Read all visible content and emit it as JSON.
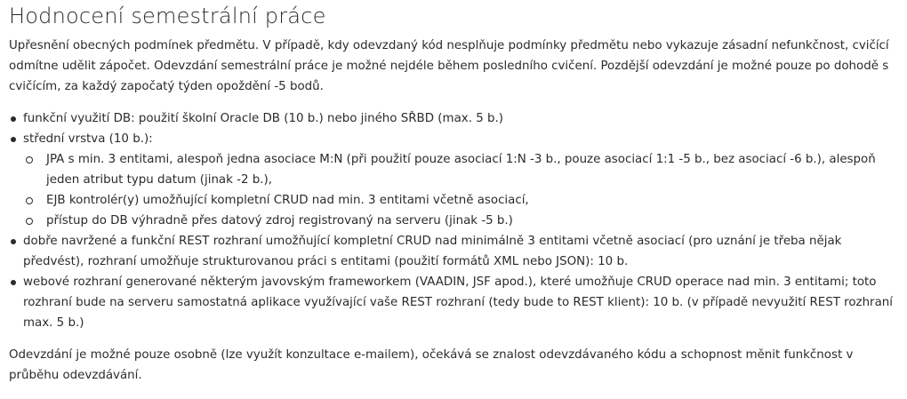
{
  "title": "Hodnocení semestrální práce",
  "intro": "Upřesnění obecných podmínek předmětu. V případě, kdy odevzdaný kód nesplňuje podmínky předmětu nebo vykazuje zásadní nefunkčnost, cvičící odmítne udělit zápočet. Odevzdání semestrální práce je možné nejdéle během posledního cvičení. Pozdější odevzdání je možné pouze po dohodě s cvičícím, za každý započatý týden opoždění -5 bodů.",
  "criteria": [
    {
      "text": "funkční využití DB: použití školní Oracle DB (10 b.) nebo jiného SŘBD (max. 5 b.)"
    },
    {
      "text": "střední vrstva (10 b.):",
      "sub": [
        "JPA s min. 3 entitami, alespoň jedna asociace M:N (při použití pouze asociací 1:N -3 b., pouze asociací 1:1 -5 b., bez asociací -6 b.), alespoň jeden atribut typu datum (jinak -2 b.),",
        "EJB kontrolér(y) umožňující kompletní CRUD nad min. 3 entitami včetně asociací,",
        "přístup do DB výhradně přes datový zdroj registrovaný na serveru (jinak -5 b.)"
      ]
    },
    {
      "text": "dobře navržené a funkční REST rozhraní umožňující kompletní CRUD nad minimálně 3 entitami včetně asociací (pro uznání je třeba nějak předvést), rozhraní umožňuje strukturovanou práci s entitami (použití formátů XML nebo JSON): 10 b."
    },
    {
      "text": "webové rozhraní generované některým javovským frameworkem (VAADIN, JSF apod.), které umožňuje CRUD operace nad min. 3 entitami; toto rozhraní bude na serveru samostatná aplikace využívající vaše REST rozhraní (tedy bude to REST klient): 10 b. (v případě nevyužití REST rozhraní  max. 5 b.)"
    }
  ],
  "outro": "Odevzdání je možné pouze osobně (lze využít konzultace e-mailem), očekává se znalost odevzdávaného kódu a schopnost měnit funkčnost v průběhu odevzdávání."
}
